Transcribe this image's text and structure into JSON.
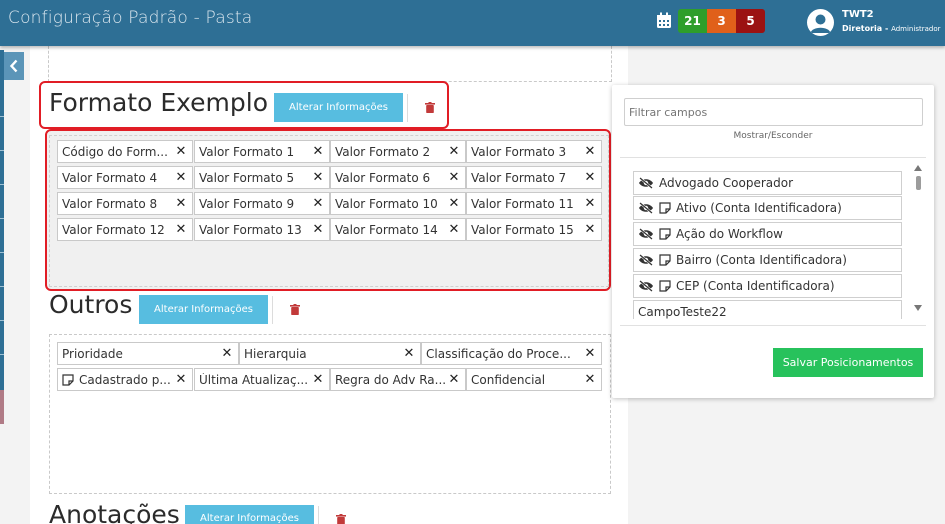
{
  "header": {
    "title": "Configuração Padrão - Pasta",
    "badges": [
      "21",
      "3",
      "5"
    ],
    "user": {
      "name": "TWT2",
      "org": "Diretoria",
      "role": "Administrador"
    }
  },
  "sections": [
    {
      "title": "Formato Exemplo",
      "button": "Alterar Informações",
      "rows": [
        [
          "Código do Form...",
          "Valor Formato 1",
          "Valor Formato 2",
          "Valor Formato 3"
        ],
        [
          "Valor Formato 4",
          "Valor Formato 5",
          "Valor Formato 6",
          "Valor Formato 7"
        ],
        [
          "Valor Formato 8",
          "Valor Formato 9",
          "Valor Formato 10",
          "Valor Formato 11"
        ],
        [
          "Valor Formato 12",
          "Valor Formato 13",
          "Valor Formato 14",
          "Valor Formato 15"
        ]
      ]
    },
    {
      "title": "Outros",
      "button": "Alterar Informações",
      "row1": [
        "Prioridade",
        "Hierarquia",
        "Classificação do Proce..."
      ],
      "row2": [
        "Cadastrado p...",
        "Última Atualizaç...",
        "Regra do Adv Ra...",
        "Confidencial"
      ]
    },
    {
      "title": "Anotações",
      "button": "Alterar Informações"
    }
  ],
  "panel": {
    "filter_placeholder": "Filtrar campos",
    "show_hide": "Mostrar/Esconder",
    "items": [
      "Advogado Cooperador",
      "Ativo (Conta Identificadora)",
      "Ação do Workflow",
      "Bairro (Conta Identificadora)",
      "CEP (Conta Identificadora)",
      "CampoTeste22"
    ],
    "save_button": "Salvar Posicionamentos"
  },
  "colors": {
    "header": "#2e6f95",
    "button_info": "#57bde0",
    "button_save": "#27c25c",
    "highlight": "#e11d25"
  }
}
